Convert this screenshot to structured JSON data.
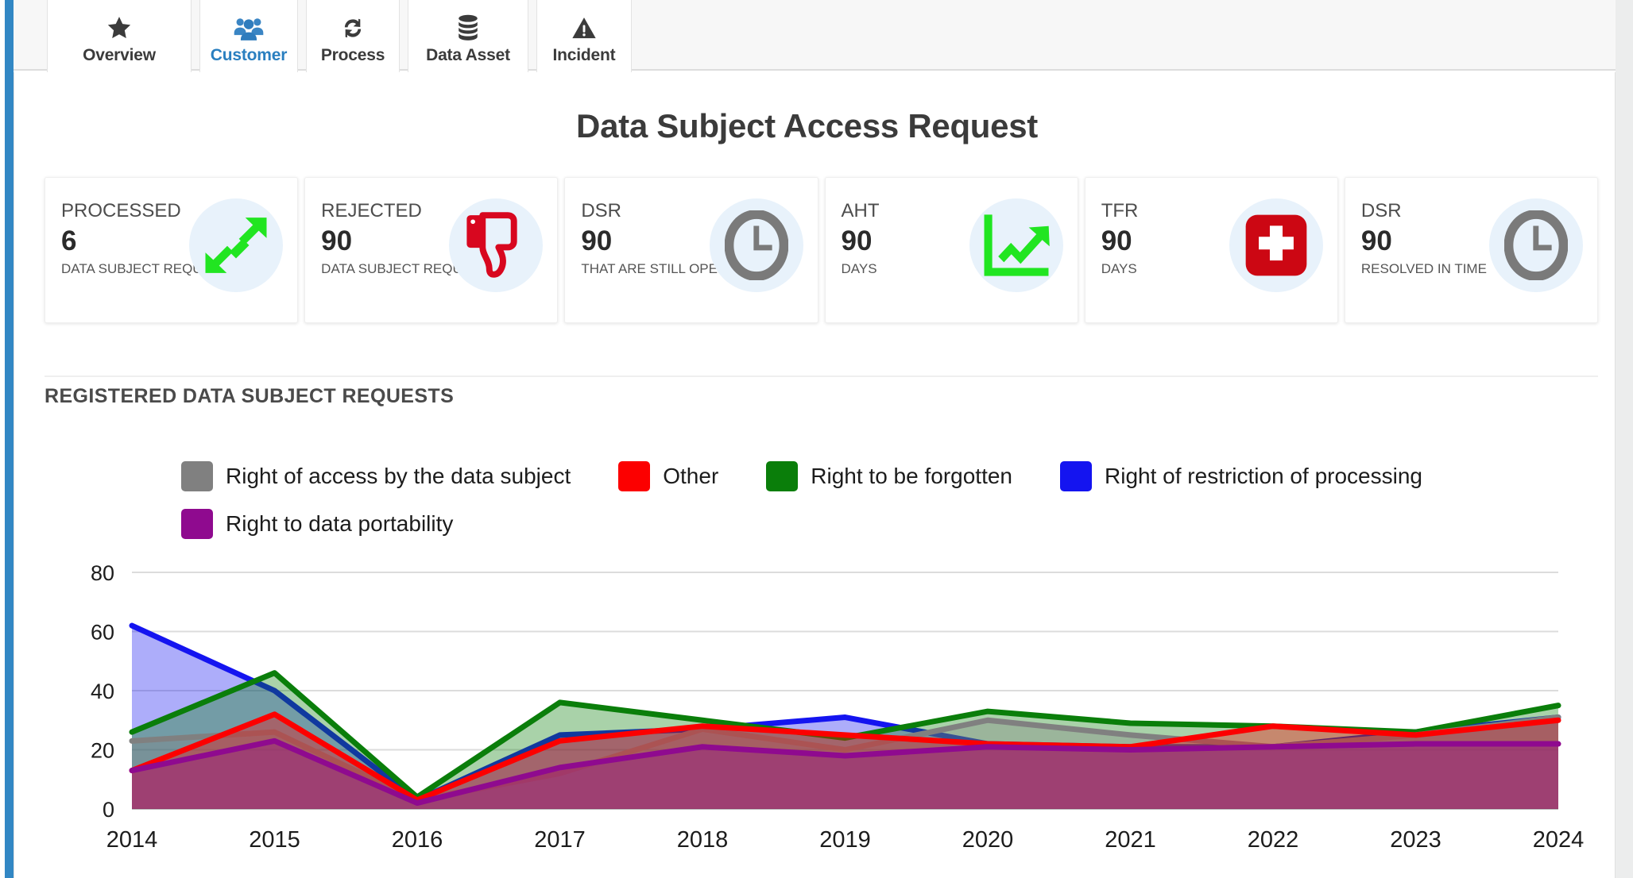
{
  "window": {
    "accent_color": "#3287c4",
    "scrollbar_color": "#eceded"
  },
  "tabs": {
    "active": "Customer",
    "items": [
      {
        "label": "Overview",
        "icon": "star-icon",
        "active": false,
        "color": "#3b3b3b"
      },
      {
        "label": "Customer",
        "icon": "users-icon",
        "active": true,
        "color": "#2a7fc0"
      },
      {
        "label": "Process",
        "icon": "refresh-icon",
        "active": false,
        "color": "#3b3b3b"
      },
      {
        "label": "Data Asset",
        "icon": "database-icon",
        "active": false,
        "color": "#3b3b3b"
      },
      {
        "label": "Incident",
        "icon": "warning-icon",
        "active": false,
        "color": "#3b3b3b"
      }
    ]
  },
  "header": {
    "title": "Data Subject Access Request"
  },
  "kpis": [
    {
      "title": "PROCESSED",
      "value": "6",
      "sub": "DATA SUBJECT REQUESTS",
      "icon": "shrink-arrows-icon",
      "icon_color": "#21e521",
      "icon_bg": "#e8f2fb"
    },
    {
      "title": "REJECTED",
      "value": "90",
      "sub": "DATA SUBJECT REQUESTS",
      "icon": "thumbs-down-icon",
      "icon_color": "#d8071f",
      "icon_bg": "#e8f2fb"
    },
    {
      "title": "DSR",
      "value": "90",
      "sub": "THAT ARE STILL OPENED",
      "icon": "clock-icon",
      "icon_color": "#7a7a7a",
      "icon_bg": "#e8f2fb"
    },
    {
      "title": "AHT",
      "value": "90",
      "sub": "DAYS",
      "icon": "trend-up-chart-icon",
      "icon_color": "#21e521",
      "icon_bg": "#e8f2fb"
    },
    {
      "title": "TFR",
      "value": "90",
      "sub": "DAYS",
      "icon": "medical-cross-icon",
      "icon_color": "#cc0713",
      "icon_bg": "#e8f2fb"
    },
    {
      "title": "DSR",
      "value": "90",
      "sub": "RESOLVED IN TIME",
      "icon": "clock-icon",
      "icon_color": "#7a7a7a",
      "icon_bg": "#e8f2fb"
    }
  ],
  "chart_section": {
    "heading": "REGISTERED DATA SUBJECT REQUESTS"
  },
  "chart_data": {
    "type": "area",
    "title": "REGISTERED DATA SUBJECT REQUESTS",
    "xlabel": "",
    "ylabel": "",
    "grid": true,
    "legend_position": "top",
    "ylim": [
      0,
      80
    ],
    "yticks": [
      "0",
      "20",
      "40",
      "60",
      "80"
    ],
    "categories": [
      "2014",
      "2015",
      "2016",
      "2017",
      "2018",
      "2019",
      "2020",
      "2021",
      "2022",
      "2023",
      "2024"
    ],
    "series": [
      {
        "name": "Right of access by the data subject",
        "color": "#808080",
        "values": [
          23,
          26,
          3,
          12,
          27,
          20,
          30,
          25,
          21,
          25,
          31
        ]
      },
      {
        "name": "Other",
        "color": "#fc0000",
        "values": [
          13,
          32,
          3,
          23,
          28,
          25,
          22,
          21,
          28,
          25,
          30
        ]
      },
      {
        "name": "Right to be forgotten",
        "color": "#0a7e0a",
        "values": [
          26,
          46,
          4,
          36,
          30,
          24,
          33,
          29,
          28,
          26,
          35
        ]
      },
      {
        "name": "Right of restriction of processing",
        "color": "#1414f0",
        "values": [
          62,
          40,
          3,
          25,
          27,
          31,
          22,
          21,
          21,
          26,
          31
        ]
      },
      {
        "name": "Right to data portability",
        "color": "#8f0a8f",
        "values": [
          13,
          23,
          2,
          14,
          21,
          18,
          21,
          20,
          21,
          22,
          22
        ]
      }
    ]
  }
}
